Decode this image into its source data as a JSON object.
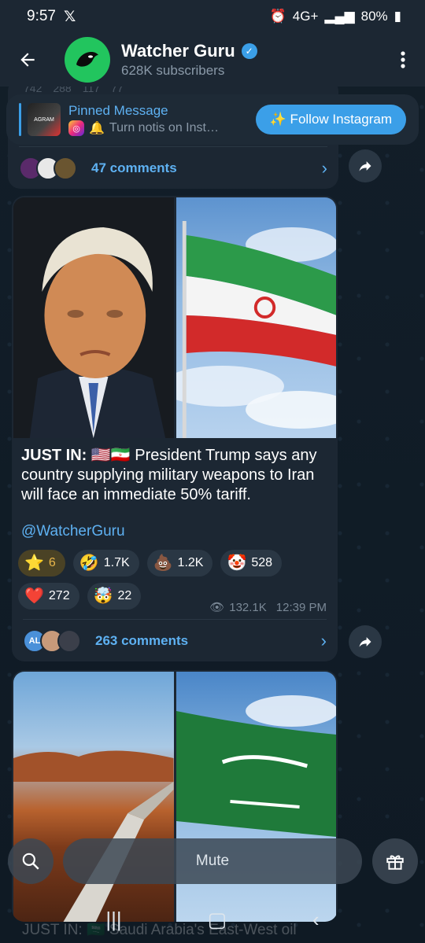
{
  "status_bar": {
    "time": "9:57",
    "app_icon": "x-logo",
    "network": "4G+",
    "battery": "80%"
  },
  "header": {
    "title": "Watcher Guru",
    "subtitle": "628K subscribers"
  },
  "pinned": {
    "title": "Pinned Message",
    "subtitle": "Turn notis on Inst…",
    "thumb_text": "AGRAM",
    "button_label": "✨ Follow Instagram"
  },
  "prev_message": {
    "reaction_counts": [
      "742",
      "288",
      "117",
      "77"
    ],
    "comments_label": "47 comments"
  },
  "message": {
    "lead": "JUST IN:",
    "text": "🇺🇸🇮🇷 President Trump says any country supplying military weapons to Iran will face an immediate 50% tariff.",
    "handle": "@WatcherGuru",
    "reactions": [
      {
        "emoji": "⭐",
        "count": "6"
      },
      {
        "emoji": "🤣",
        "count": "1.7K"
      },
      {
        "emoji": "💩",
        "count": "1.2K"
      },
      {
        "emoji": "🤡",
        "count": "528"
      },
      {
        "emoji": "❤️",
        "count": "272"
      },
      {
        "emoji": "🤯",
        "count": "22"
      }
    ],
    "views": "132.1K",
    "time": "12:39 PM",
    "comments_label": "263 comments",
    "comment_avatar_initials": "AL"
  },
  "next_message": {
    "caption": "JUST IN: 🇸🇦 Saudi Arabia's East-West oil"
  },
  "bottom": {
    "mute_label": "Mute"
  },
  "colors": {
    "accent": "#3b9fe8",
    "link": "#5eb1f2",
    "bubble": "#1c2733",
    "background": "#0f1a24"
  }
}
